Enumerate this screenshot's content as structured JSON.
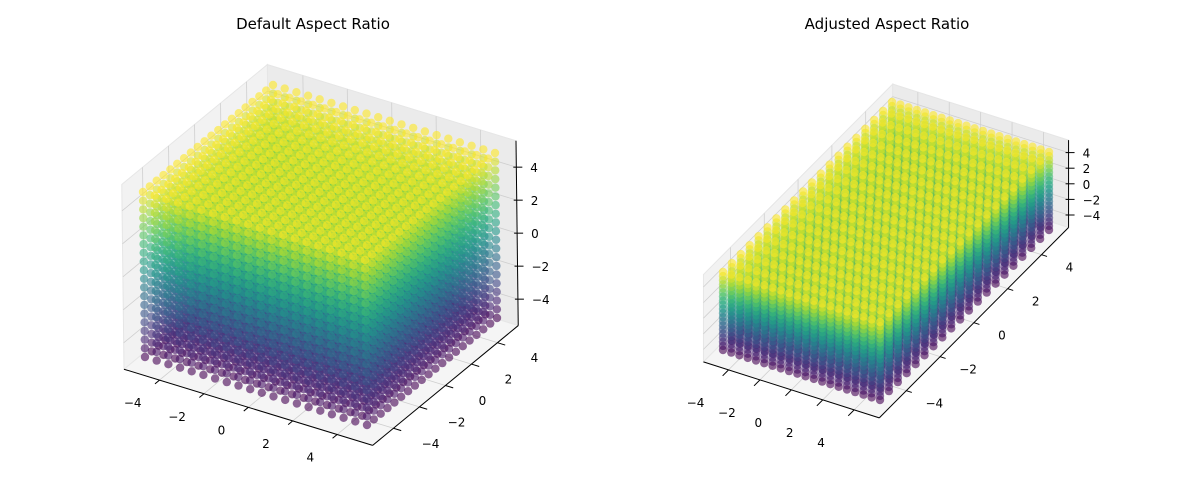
{
  "chart_data": [
    {
      "type": "scatter",
      "projection": "3d",
      "title": "Default Aspect Ratio",
      "grid_values": [
        -5,
        -4.474,
        -3.947,
        -3.421,
        -2.895,
        -2.368,
        -1.842,
        -1.316,
        -0.789,
        -0.263,
        0.263,
        0.789,
        1.316,
        1.842,
        2.368,
        2.895,
        3.421,
        3.947,
        4.474,
        5
      ],
      "points": "full meshgrid of grid_values along x, y and z",
      "color_by": "z",
      "colormap": "viridis",
      "x_ticks": [
        "−4",
        "−2",
        "0",
        "2",
        "4"
      ],
      "y_ticks": [
        "−4",
        "−2",
        "0",
        "2",
        "4"
      ],
      "z_ticks": [
        "−4",
        "−2",
        "0",
        "2",
        "4"
      ],
      "xlim": [
        -5.5,
        5.5
      ],
      "ylim": [
        -5.5,
        5.5
      ],
      "zlim": [
        -5.5,
        5.5
      ],
      "box_aspect": [
        1,
        1,
        1
      ],
      "grid": true
    },
    {
      "type": "scatter",
      "projection": "3d",
      "title": "Adjusted Aspect Ratio",
      "grid_values": [
        -5,
        -4.474,
        -3.947,
        -3.421,
        -2.895,
        -2.368,
        -1.842,
        -1.316,
        -0.789,
        -0.263,
        0.263,
        0.789,
        1.316,
        1.842,
        2.368,
        2.895,
        3.421,
        3.947,
        4.474,
        5
      ],
      "points": "full meshgrid of grid_values along x, y and z",
      "color_by": "z",
      "colormap": "viridis",
      "x_ticks": [
        "−4",
        "−2",
        "0",
        "2",
        "4"
      ],
      "y_ticks": [
        "−4",
        "−2",
        "0",
        "2",
        "4"
      ],
      "z_ticks": [
        "−4",
        "−2",
        "0",
        "2",
        "4"
      ],
      "xlim": [
        -5.5,
        5.5
      ],
      "ylim": [
        -5.5,
        5.5
      ],
      "zlim": [
        -5.5,
        5.5
      ],
      "box_aspect": [
        2,
        2,
        0.5
      ],
      "grid": true
    }
  ]
}
